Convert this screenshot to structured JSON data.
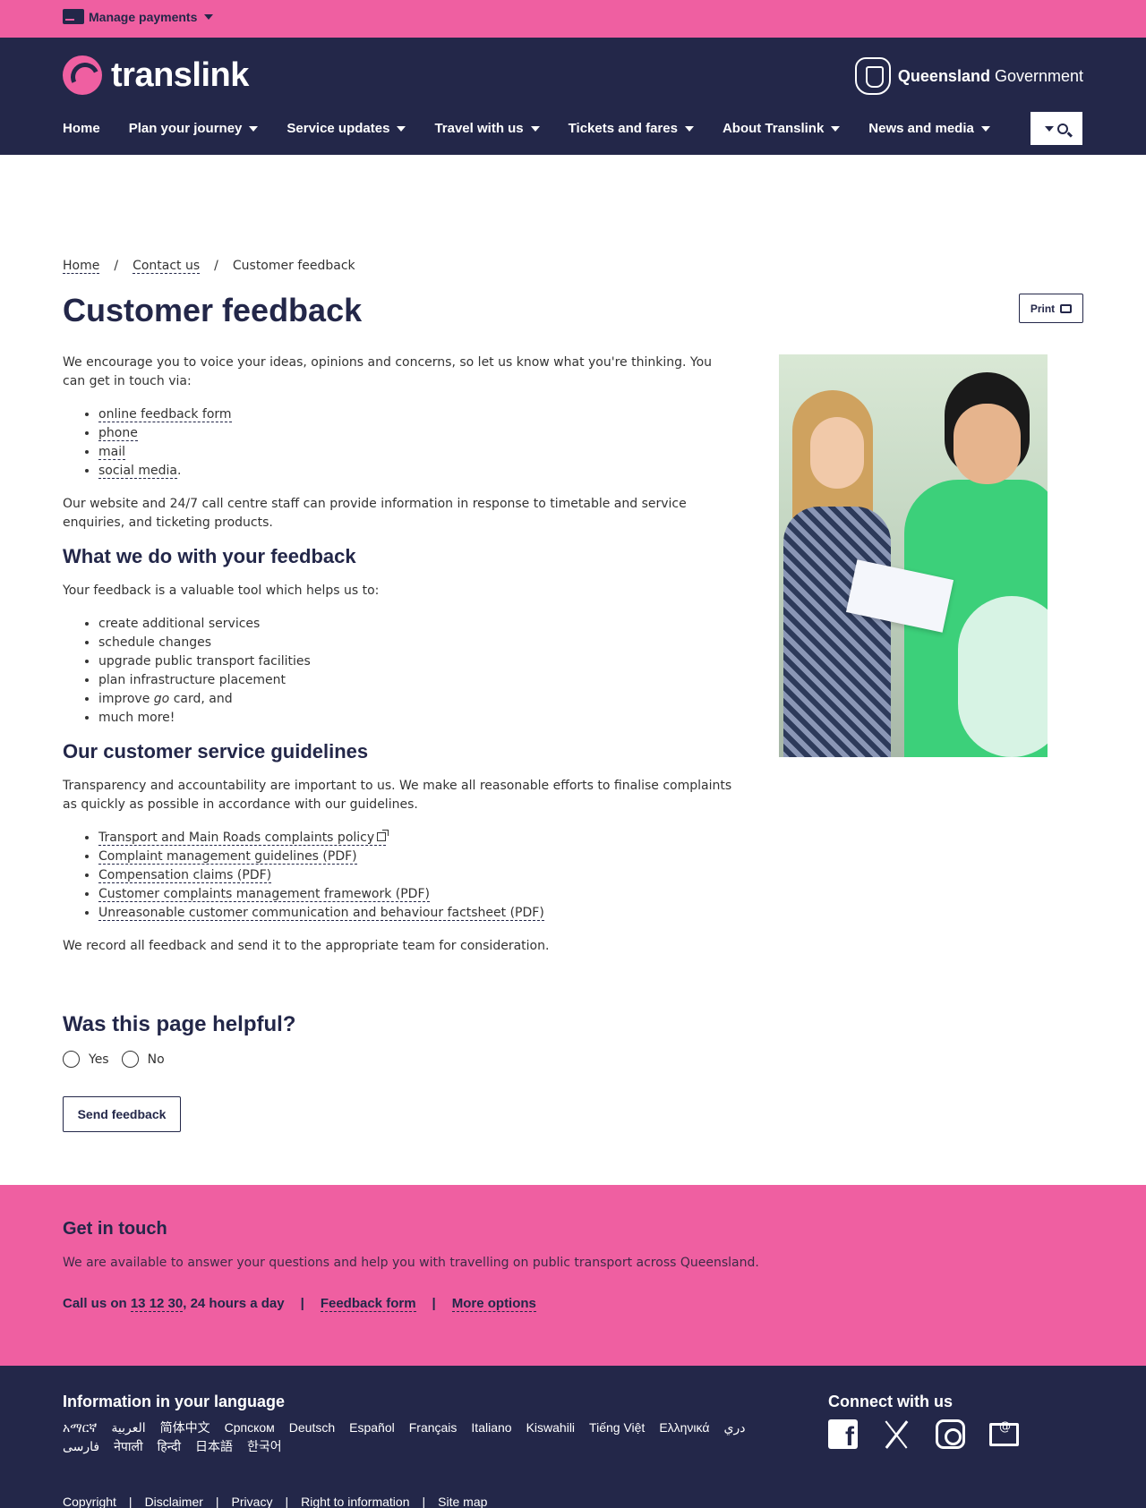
{
  "topbar": {
    "manage_payments": "Manage payments",
    "card_icon": "card-icon"
  },
  "header": {
    "logo_text": "translink",
    "gov_bold": "Queensland",
    "gov_regular": "Government",
    "nav": [
      "Home",
      "Plan your journey",
      "Service updates",
      "Travel with us",
      "Tickets and fares",
      "About Translink",
      "News and media"
    ]
  },
  "breadcrumb": {
    "home": "Home",
    "contact": "Contact us",
    "current": "Customer feedback",
    "sep": "/"
  },
  "page": {
    "title": "Customer feedback",
    "print": "Print"
  },
  "content": {
    "intro": "We encourage you to voice your ideas, opinions and concerns, so let us know what you're thinking. You can get in touch via:",
    "contact_links": [
      "online feedback form",
      "phone",
      "mail",
      "social media"
    ],
    "call_centre": "Our website and 24/7 call centre staff can provide information in response to timetable and service enquiries, and ticketing products.",
    "h_feedback": "What we do with your feedback",
    "feedback_intro": "Your feedback is a valuable tool which helps us to:",
    "feedback_items": [
      "create additional services",
      "schedule changes",
      "upgrade public transport facilities",
      "plan infrastructure placement",
      "card, and",
      "much more!"
    ],
    "improve_prefix": "improve ",
    "improve_go": "go",
    "h_guidelines": "Our customer service guidelines",
    "guidelines_intro": "Transparency and accountability are important to us. We make all reasonable efforts to finalise complaints as quickly as possible in accordance with our guidelines.",
    "guideline_links": [
      "Transport and Main Roads complaints policy",
      "Complaint management guidelines (PDF)",
      "Compensation claims (PDF)",
      "Customer complaints management framework (PDF)",
      "Unreasonable customer communication and behaviour factsheet (PDF)"
    ],
    "record": "We record all feedback and send it to the appropriate team for consideration."
  },
  "helpful": {
    "title": "Was this page helpful?",
    "yes": "Yes",
    "no": "No",
    "send": "Send feedback"
  },
  "touch": {
    "title": "Get in touch",
    "text": "We are available to answer your questions and help you with travelling on public transport across Queensland.",
    "call_prefix": "Call us on ",
    "phone": "13 12 30",
    "call_suffix": ", 24 hours a day",
    "feedback_form": "Feedback form",
    "more_options": "More options",
    "pipe": "|"
  },
  "footer": {
    "lang_title": "Information in your language",
    "languages": [
      "አማርኛ",
      "العربية",
      "简体中文",
      "Српском",
      "Deutsch",
      "Español",
      "Français",
      "Italiano",
      "Kiswahili",
      "Tiếng Việt",
      "Ελληνικά",
      "دري",
      "فارسی",
      "नेपाली",
      "हिन्दी",
      "日本語",
      "한국어"
    ],
    "connect_title": "Connect with us",
    "links": [
      "Copyright",
      "Disclaimer",
      "Privacy",
      "Right to information",
      "Site map"
    ]
  }
}
